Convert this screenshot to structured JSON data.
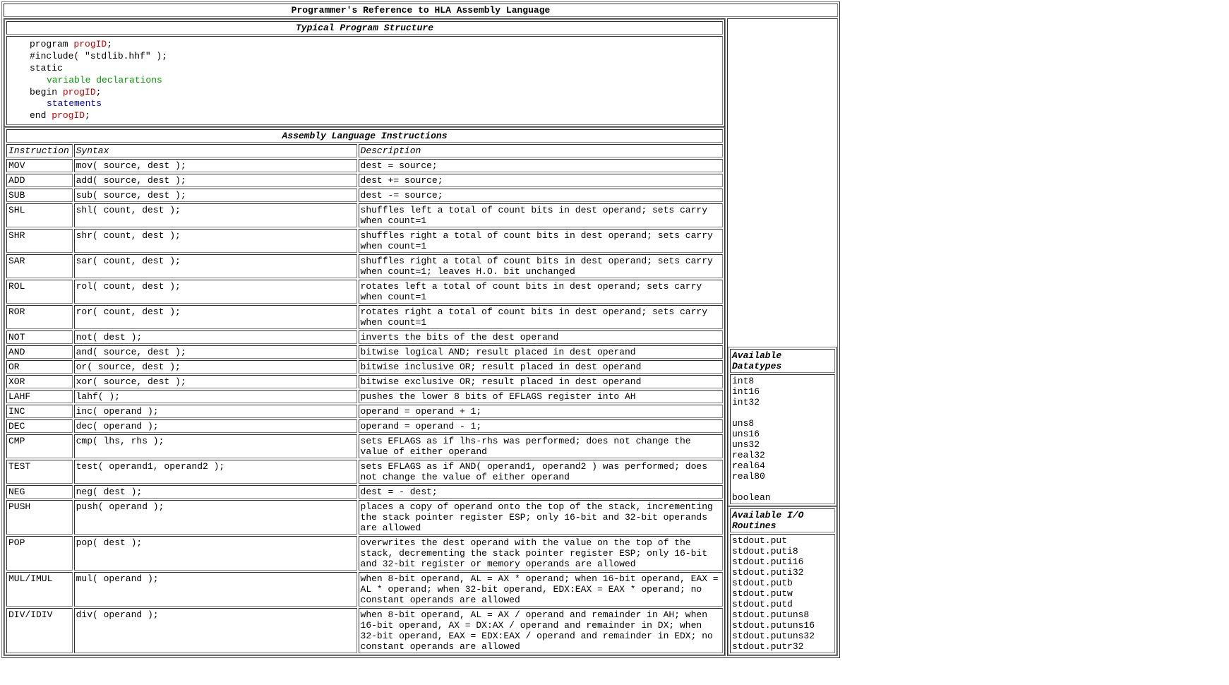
{
  "title": "Programmer's Reference to HLA Assembly Language",
  "struct_heading": "Typical Program Structure",
  "instr_heading": "Assembly Language Instructions",
  "code": {
    "l1a": "program ",
    "l1b": "progID",
    "l1c": ";",
    "l2": "#include( \"stdlib.hhf\" );",
    "l3": "static",
    "l4": "variable declarations",
    "l5a": "begin ",
    "l5b": "progID",
    "l5c": ";",
    "l6": "statements",
    "l7a": "end ",
    "l7b": "progID",
    "l7c": ";"
  },
  "cols": {
    "c1": "Instruction",
    "c2": "Syntax",
    "c3": "Description"
  },
  "rows": [
    {
      "i": "MOV",
      "s": "mov( source, dest );",
      "d": "dest = source;"
    },
    {
      "i": "ADD",
      "s": "add( source, dest );",
      "d": "dest += source;"
    },
    {
      "i": "SUB",
      "s": "sub( source, dest );",
      "d": "dest -= source;"
    },
    {
      "i": "SHL",
      "s": "shl( count, dest );",
      "d": "shuffles left a total of count bits in dest operand; sets carry when count=1"
    },
    {
      "i": "SHR",
      "s": "shr( count, dest );",
      "d": "shuffles right a total of count bits in dest operand; sets carry when count=1"
    },
    {
      "i": "SAR",
      "s": "sar( count, dest );",
      "d": "shuffles right a total of count bits in dest operand; sets carry when count=1; leaves H.O. bit unchanged"
    },
    {
      "i": "ROL",
      "s": "rol( count, dest );",
      "d": "rotates left a total of count bits in dest operand; sets carry when count=1"
    },
    {
      "i": "ROR",
      "s": "ror( count, dest );",
      "d": "rotates right a total of count bits in dest operand; sets carry when count=1"
    },
    {
      "i": "NOT",
      "s": "not( dest );",
      "d": "inverts the bits of the dest operand"
    },
    {
      "i": "AND",
      "s": "and( source, dest );",
      "d": "bitwise logical AND; result placed in dest operand"
    },
    {
      "i": "OR",
      "s": "or( source, dest );",
      "d": "bitwise inclusive OR; result placed in dest operand"
    },
    {
      "i": "XOR",
      "s": "xor( source, dest );",
      "d": "bitwise exclusive OR; result placed in dest operand"
    },
    {
      "i": "LAHF",
      "s": "lahf( );",
      "d": "pushes the lower 8 bits of EFLAGS register into AH"
    },
    {
      "i": "INC",
      "s": "inc( operand );",
      "d": "operand = operand + 1;"
    },
    {
      "i": "DEC",
      "s": "dec( operand );",
      "d": "operand = operand - 1;"
    },
    {
      "i": "CMP",
      "s": "cmp( lhs, rhs );",
      "d": "sets EFLAGS as if lhs-rhs was performed; does not change the value of either operand"
    },
    {
      "i": "TEST",
      "s": "test( operand1, operand2 );",
      "d": "sets EFLAGS as if AND( operand1, operand2 ) was performed; does not change the value of either operand"
    },
    {
      "i": "NEG",
      "s": "neg( dest );",
      "d": "dest = - dest;"
    },
    {
      "i": "PUSH",
      "s": "push( operand );",
      "d": "places a copy of operand onto the top of the stack, incrementing the stack pointer register ESP; only 16-bit and 32-bit operands are allowed"
    },
    {
      "i": "POP",
      "s": "pop( dest );",
      "d": "overwrites the dest operand with the value on the top of the stack, decrementing the stack pointer register ESP; only 16-bit and 32-bit register or memory operands are allowed"
    },
    {
      "i": "MUL/IMUL",
      "s": "mul( operand );",
      "d": "when 8-bit operand, AL = AX * operand; when 16-bit operand, EAX = AL * operand; when 32-bit operand, EDX:EAX = EAX * operand; no constant operands are allowed"
    },
    {
      "i": "DIV/IDIV",
      "s": "div( operand );",
      "d": "when 8-bit operand, AL = AX / operand and remainder in AH; when 16-bit operand, AX = DX:AX / operand and remainder in DX; when 32-bit operand, EAX = EDX:EAX / operand and remainder in EDX; no constant operands are allowed"
    }
  ],
  "side": {
    "datatypes_header": "Available Datatypes",
    "datatypes": "int8\nint16\nint32\n\nuns8\nuns16\nuns32\nreal32\nreal64\nreal80\n\nboolean",
    "io_header": "Available I/O Routines",
    "io": "stdout.put\nstdout.puti8\nstdout.puti16\nstdout.puti32\nstdout.putb\nstdout.putw\nstdout.putd\nstdout.putuns8\nstdout.putuns16\nstdout.putuns32\nstdout.putr32"
  }
}
